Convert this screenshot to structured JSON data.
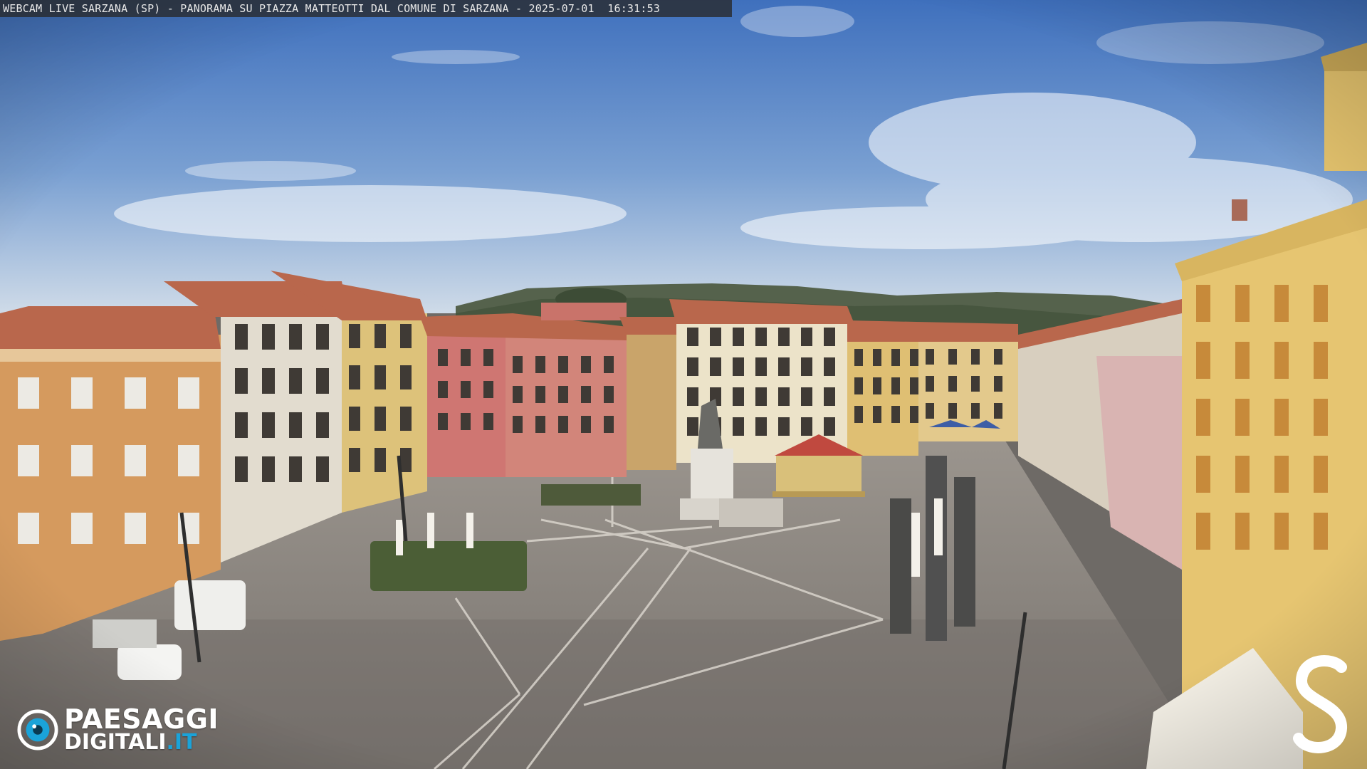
{
  "overlay": {
    "title": "WEBCAM LIVE SARZANA (SP) - PANORAMA SU PIAZZA MATTEOTTI DAL COMUNE DI SARZANA - 2025-07-01  16:31:53"
  },
  "logo": {
    "line1": "PAESAGGI",
    "line2_main": "DIGITALI",
    "line2_suffix": ".IT",
    "suffix_color": "#1aa3d9"
  },
  "brand_mark": "S",
  "colors": {
    "sky_top": "#4a7cc4",
    "sky_bottom": "#c9d7e6",
    "pavement": "#8a8580",
    "facade_orange": "#d59a5e",
    "facade_pink": "#cf7672",
    "facade_yellow": "#ddc27a",
    "facade_cream": "#e6dcc2",
    "roof_tile": "#b9674c"
  }
}
